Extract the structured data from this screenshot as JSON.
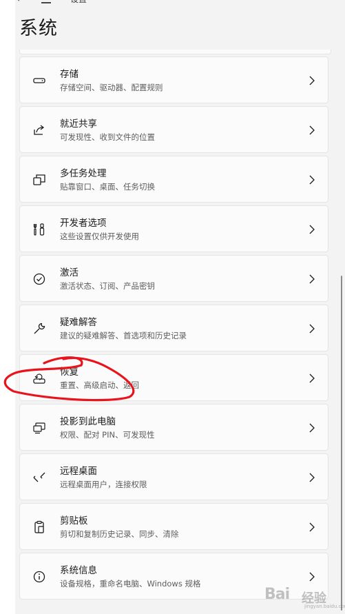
{
  "header": {
    "back_glyph": "←",
    "nav_title": "设置",
    "page_title": "系统"
  },
  "items": [
    {
      "label": "存储",
      "desc": "存储空间、驱动器、配置规则",
      "icon": "storage-icon"
    },
    {
      "label": "就近共享",
      "desc": "可发现性、收到文件的位置",
      "icon": "share-icon"
    },
    {
      "label": "多任务处理",
      "desc": "贴靠窗口、桌面、任务切换",
      "icon": "multitasking-icon"
    },
    {
      "label": "开发者选项",
      "desc": "这些设置仅供开发使用",
      "icon": "developer-tools-icon"
    },
    {
      "label": "激活",
      "desc": "激活状态、订阅、产品密钥",
      "icon": "activation-check-icon"
    },
    {
      "label": "疑难解答",
      "desc": "建议的疑难解答、首选项和历史记录",
      "icon": "wrench-icon"
    },
    {
      "label": "恢复",
      "desc": "重置、高级启动、返回",
      "icon": "recovery-icon"
    },
    {
      "label": "投影到此电脑",
      "desc": "权限、配对 PIN、可发现性",
      "icon": "projection-icon"
    },
    {
      "label": "远程桌面",
      "desc": "远程桌面用户，连接权限",
      "icon": "remote-desktop-icon"
    },
    {
      "label": "剪贴板",
      "desc": "剪切和复制历史记录、同步、清除",
      "icon": "clipboard-icon"
    },
    {
      "label": "系统信息",
      "desc": "设备规格，重命名电脑、Windows 规格",
      "icon": "info-icon"
    }
  ],
  "watermark": {
    "latin": "Bai",
    "cn": "经验",
    "sub": "jingyan.baidu.com"
  },
  "colors": {
    "annotation_red": "#e8141b",
    "card_bg": "#fbfbfb",
    "page_bg": "#f3f3f3"
  }
}
